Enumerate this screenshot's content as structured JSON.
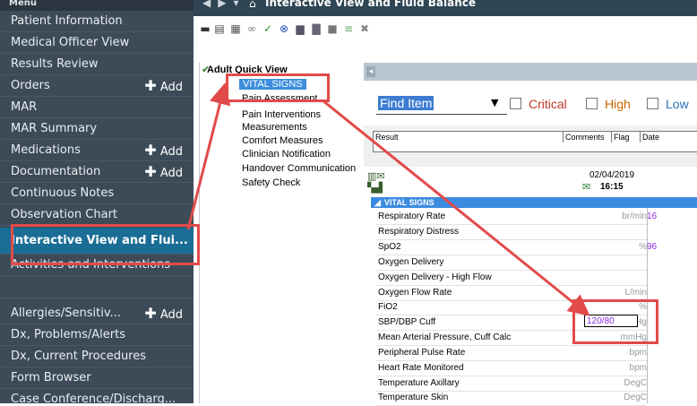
{
  "sidebar": {
    "header": "Menu",
    "items": [
      {
        "label": "Patient Information"
      },
      {
        "label": "Medical Officer View"
      },
      {
        "label": "Results Review"
      },
      {
        "label": "Orders",
        "add": "Add"
      },
      {
        "label": "MAR"
      },
      {
        "label": "MAR Summary"
      },
      {
        "label": "Medications",
        "add": "Add"
      },
      {
        "label": "Documentation",
        "add": "Add"
      },
      {
        "label": "Continuous Notes"
      },
      {
        "label": "Observation Chart"
      },
      {
        "label": "Interactive View and Flui...",
        "active": true
      },
      {
        "label": "Activities and Interventions"
      },
      {
        "label": ""
      },
      {
        "label": "Allergies/Sensitiv...",
        "add": "Add"
      },
      {
        "label": "Dx, Problems/Alerts"
      },
      {
        "label": "Dx, Current Procedures"
      },
      {
        "label": "Form Browser"
      },
      {
        "label": "Case Conference/Discharg..."
      }
    ]
  },
  "topbar": {
    "title": "Interactive View and Fluid Balance"
  },
  "quickview": {
    "title": "Adult Quick View",
    "items": [
      {
        "label": "VITAL SIGNS",
        "selected": true
      },
      {
        "label": "Pain Assessment"
      },
      {
        "label": "Pain Interventions"
      },
      {
        "label": "Measurements"
      },
      {
        "label": "Comfort Measures"
      },
      {
        "label": "Clinician Notification"
      },
      {
        "label": "Handover Communication"
      },
      {
        "label": "Safety Check"
      }
    ]
  },
  "find": {
    "text": "Find Item",
    "filters": [
      {
        "label": "Critical",
        "color": "#c0392b"
      },
      {
        "label": "High",
        "color": "#c96a00"
      },
      {
        "label": "Low",
        "color": "#2b6fb7"
      }
    ]
  },
  "result_columns": [
    "Result",
    "Comments",
    "Flag",
    "Date"
  ],
  "grid": {
    "date": "02/04/2019",
    "time": "16:15",
    "section": "VITAL SIGNS",
    "rows": [
      {
        "label": "Respiratory Rate",
        "unit": "br/min",
        "value": "16"
      },
      {
        "label": "Respiratory Distress",
        "unit": "",
        "value": ""
      },
      {
        "label": "SpO2",
        "unit": "%",
        "value": "96"
      },
      {
        "label": "Oxygen Delivery",
        "unit": "",
        "value": ""
      },
      {
        "label": "Oxygen Delivery - High Flow",
        "unit": "",
        "value": ""
      },
      {
        "label": "Oxygen Flow Rate",
        "unit": "L/min",
        "value": ""
      },
      {
        "label": "FiO2",
        "unit": "%",
        "value": ""
      },
      {
        "label": "SBP/DBP Cuff",
        "unit": "mmHg",
        "value": "120/80"
      },
      {
        "label": "Mean Arterial Pressure, Cuff Calc",
        "unit": "mmHg",
        "value": ""
      },
      {
        "label": "Peripheral Pulse Rate",
        "unit": "bpm",
        "value": ""
      },
      {
        "label": "Heart Rate Monitored",
        "unit": "bpm",
        "value": ""
      },
      {
        "label": "Temperature Axillary",
        "unit": "DegC",
        "value": ""
      },
      {
        "label": "Temperature Skin",
        "unit": "DegC",
        "value": ""
      }
    ]
  },
  "colors": {
    "sidebar": "#3d4b58",
    "active": "#1a6e96",
    "annotation": "#e24a4a",
    "section": "#3b8be0",
    "value": "#8a2be2"
  }
}
